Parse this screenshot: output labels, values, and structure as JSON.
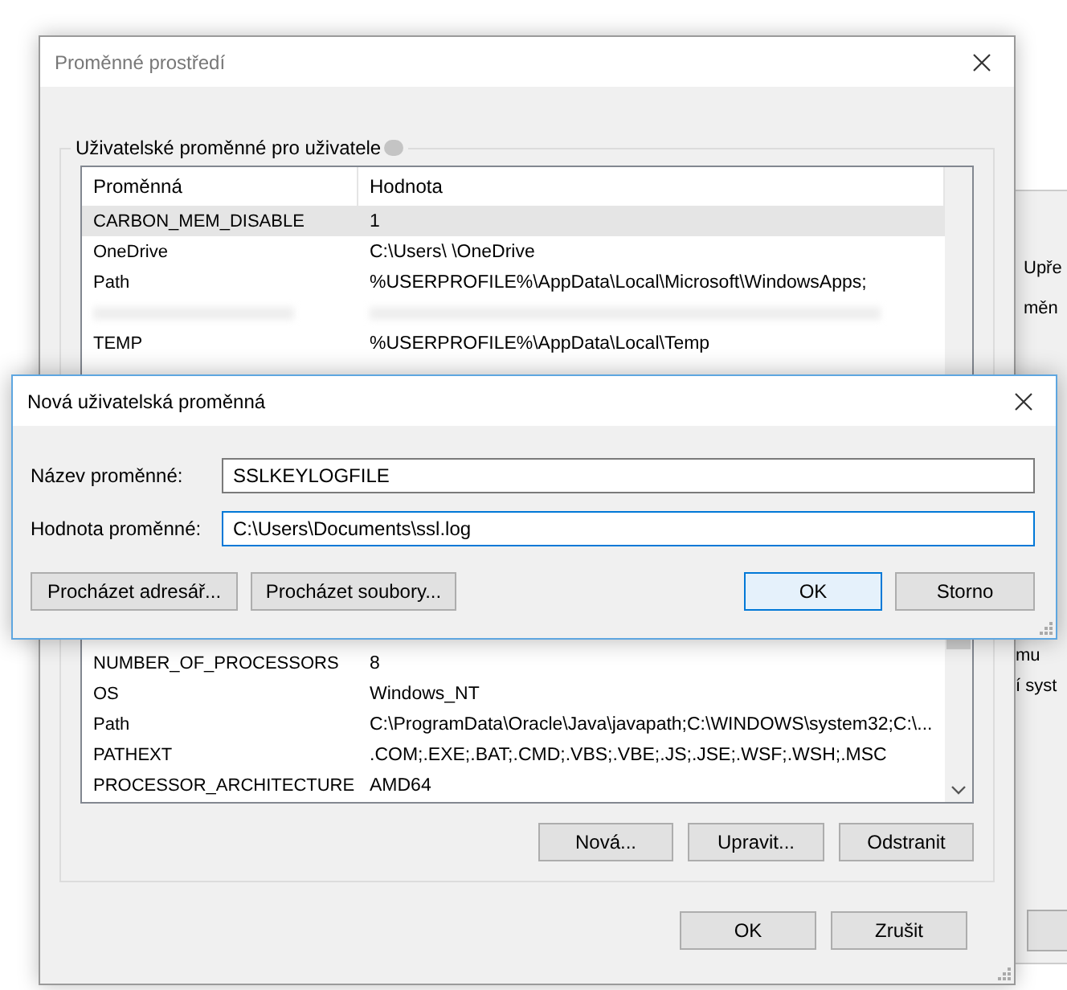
{
  "background_window": {
    "texts": [
      "Upře",
      "měn",
      "mu",
      "í syst"
    ]
  },
  "main_dialog": {
    "title": "Proměnné prostředí",
    "group_label": "Uživatelské proměnné pro uživatele",
    "columns": [
      "Proměnná",
      "Hodnota"
    ],
    "rows": [
      {
        "kind": "row",
        "name": "CARBON_MEM_DISABLE",
        "value": "1",
        "selected": true
      },
      {
        "kind": "row",
        "name": "OneDrive",
        "value": "C:\\Users\\     \\OneDrive",
        "selected": false
      },
      {
        "kind": "row",
        "name": "Path",
        "value": "%USERPROFILE%\\AppData\\Local\\Microsoft\\WindowsApps;",
        "selected": false
      },
      {
        "kind": "redacted",
        "selected": false
      },
      {
        "kind": "row",
        "name": "TEMP",
        "value": "%USERPROFILE%\\AppData\\Local\\Temp",
        "selected": false
      },
      {
        "kind": "gap"
      },
      {
        "kind": "row",
        "name": "NUMBER_OF_PROCESSORS",
        "value": "8",
        "selected": false
      },
      {
        "kind": "row",
        "name": "OS",
        "value": "Windows_NT",
        "selected": false
      },
      {
        "kind": "row",
        "name": "Path",
        "value": "C:\\ProgramData\\Oracle\\Java\\javapath;C:\\WINDOWS\\system32;C:\\...",
        "selected": false
      },
      {
        "kind": "row",
        "name": "PATHEXT",
        "value": ".COM;.EXE;.BAT;.CMD;.VBS;.VBE;.JS;.JSE;.WSF;.WSH;.MSC",
        "selected": false
      },
      {
        "kind": "row",
        "name": "PROCESSOR_ARCHITECTURE",
        "value": "AMD64",
        "selected": false
      }
    ],
    "list_buttons": [
      "Nová...",
      "Upravit...",
      "Odstranit"
    ],
    "buttons": [
      "OK",
      "Zrušit"
    ]
  },
  "new_variable_dialog": {
    "title": "Nová uživatelská proměnná",
    "fields": [
      {
        "label": "Název proměnné:",
        "value": "SSLKEYLOGFILE",
        "focused": false
      },
      {
        "label": "Hodnota proměnné:",
        "value": "C:\\Users\\Documents\\ssl.log",
        "focused": true
      }
    ],
    "buttons": [
      {
        "label": "Procházet adresář...",
        "default": false
      },
      {
        "label": "Procházet soubory...",
        "default": false
      },
      {
        "label": "OK",
        "default": true
      },
      {
        "label": "Storno",
        "default": false
      }
    ]
  }
}
